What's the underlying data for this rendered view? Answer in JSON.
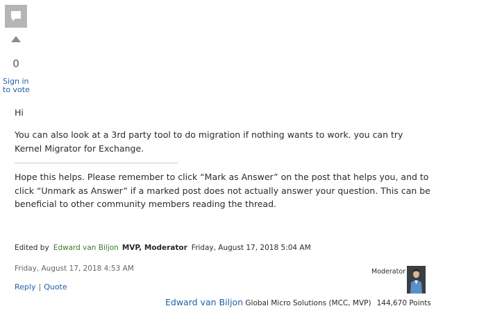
{
  "vote": {
    "count": "0",
    "sign_in_label": "Sign in to vote"
  },
  "post": {
    "greeting": "Hi",
    "message": "You can also look at a 3rd party tool to do migration if nothing wants to work. you can try Kernel Migrator for Exchange.",
    "signature": "Hope this helps. Please remember to click “Mark as Answer” on the post that helps you, and to click “Unmark as Answer” if a marked post does not actually answer your question. This can be beneficial to other community members reading the thread.",
    "edited_prefix": "Edited by",
    "edited_author": "Edward van Biljon",
    "edited_roles": "MVP, Moderator",
    "edited_date": "Friday, August 17, 2018 5:04 AM",
    "posted_date": "Friday, August 17, 2018 4:53 AM"
  },
  "actions": {
    "reply_label": "Reply",
    "separator": "|",
    "quote_label": "Quote"
  },
  "author": {
    "badge": "Moderator",
    "name": "Edward van Biljon",
    "affiliation": "Global Micro Solutions (MCC, MVP)",
    "points": "144,670 Points"
  },
  "colors": {
    "link": "#1f5fa8",
    "edited_author": "#3d7a2b",
    "icon_gray": "#b5b5b5"
  },
  "icons": {
    "post_type": "speech-bubble-icon",
    "vote_up": "triangle-up-icon"
  }
}
